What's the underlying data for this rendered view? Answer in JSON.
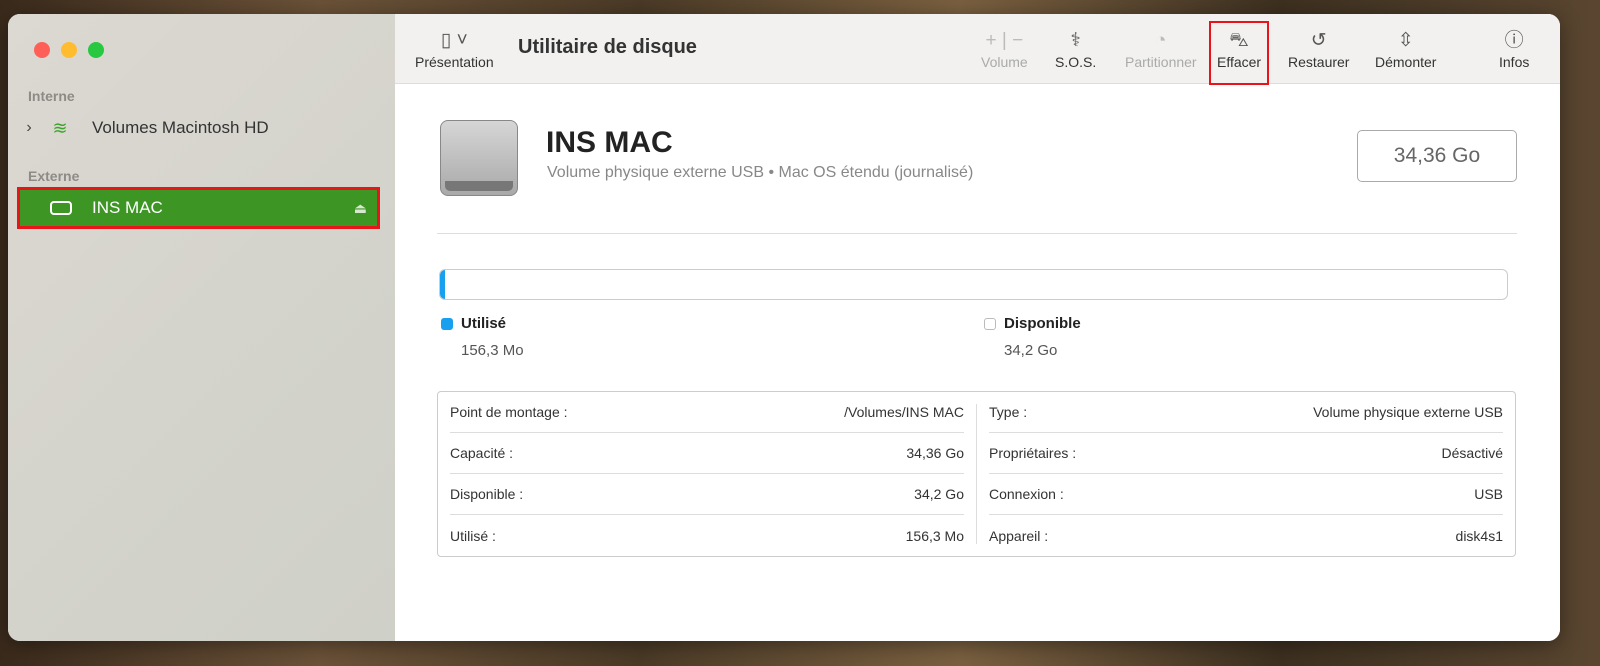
{
  "window": {
    "title": "Utilitaire de disque"
  },
  "sidebar": {
    "sections": [
      {
        "label": "Interne",
        "items": [
          {
            "label": "Volumes Macintosh HD"
          }
        ]
      },
      {
        "label": "Externe",
        "items": [
          {
            "label": "INS MAC"
          }
        ]
      }
    ]
  },
  "toolbar": {
    "presentation": "Présentation",
    "volume": "Volume",
    "sos": "S.O.S.",
    "partition": "Partitionner",
    "erase": "Effacer",
    "restore": "Restaurer",
    "unmount": "Démonter",
    "info": "Infos"
  },
  "disk": {
    "name": "INS MAC",
    "description": "Volume physique externe USB • Mac OS étendu (journalisé)",
    "capacity": "34,36 Go",
    "used_fraction": 0.0045,
    "used_label": "Utilisé",
    "used_value": "156,3 Mo",
    "free_label": "Disponible",
    "free_value": "34,2 Go"
  },
  "colors": {
    "accent": "#3d9624",
    "used": "#18a0f0",
    "highlight": "#e8141a"
  },
  "details": {
    "left": [
      {
        "k": "Point de montage :",
        "v": "/Volumes/INS MAC"
      },
      {
        "k": "Capacité :",
        "v": "34,36 Go"
      },
      {
        "k": "Disponible :",
        "v": "34,2 Go"
      },
      {
        "k": "Utilisé :",
        "v": "156,3 Mo"
      }
    ],
    "right": [
      {
        "k": "Type :",
        "v": "Volume physique externe USB"
      },
      {
        "k": "Propriétaires :",
        "v": "Désactivé"
      },
      {
        "k": "Connexion :",
        "v": "USB"
      },
      {
        "k": "Appareil :",
        "v": "disk4s1"
      }
    ]
  }
}
